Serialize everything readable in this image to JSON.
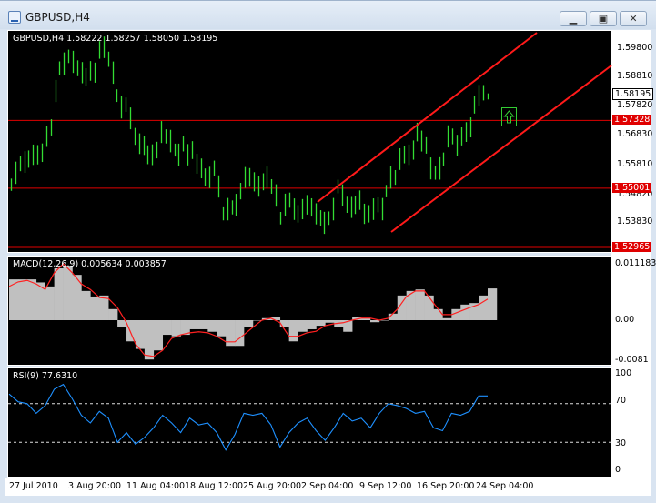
{
  "window": {
    "title": "GBPUSD,H4",
    "buttons": [
      "minimize",
      "maximize",
      "close"
    ]
  },
  "price_pane": {
    "legend": "GBPUSD,H4  1.58222 1.58257 1.58050 1.58195",
    "axis_labels": [
      "1.59800",
      "1.58810",
      "1.57820",
      "1.56830",
      "1.55810",
      "1.54820",
      "1.53830"
    ],
    "current_price": "1.58195",
    "hlines": [
      "1.57328",
      "1.55001",
      "1.52965"
    ]
  },
  "macd_pane": {
    "legend": "MACD(12,26,9) 0.005634 0.003857",
    "axis_labels": [
      "0.011183",
      "0.00",
      "-0.0081"
    ]
  },
  "rsi_pane": {
    "legend": "RSI(9) 77.6310",
    "axis_labels": [
      "100",
      "70",
      "30",
      "0"
    ]
  },
  "time_axis": [
    "27 Jul 2010",
    "3 Aug 20:00",
    "11 Aug 04:00",
    "18 Aug 12:00",
    "25 Aug 20:00",
    "2 Sep 04:00",
    "9 Sep 12:00",
    "16 Sep 20:00",
    "24 Sep 04:00"
  ],
  "colors": {
    "bars": "#33dd33",
    "hline": "#e00000",
    "macd_hist": "#c0c0c0",
    "macd_signal": "#ff2020",
    "rsi": "#1e90ff"
  },
  "chart_data": [
    {
      "type": "bar",
      "title": "GBPUSD,H4",
      "ylim": [
        1.5297,
        1.598
      ],
      "typical_range": 0.007,
      "last_bar": {
        "open": 1.58222,
        "high": 1.58257,
        "low": 1.5805,
        "close": 1.58195
      },
      "mid_prices": [
        1.5512,
        1.5553,
        1.5584,
        1.559,
        1.56,
        1.5615,
        1.5615,
        1.5622,
        1.5678,
        1.5709,
        1.5834,
        1.5912,
        1.5928,
        1.5953,
        1.5934,
        1.5912,
        1.5897,
        1.5881,
        1.5903,
        1.5897,
        1.5975,
        1.5984,
        1.5943,
        1.5897,
        1.5818,
        1.5778,
        1.5787,
        1.574,
        1.5678,
        1.5653,
        1.5647,
        1.5615,
        1.5615,
        1.5631,
        1.5693,
        1.5678,
        1.5662,
        1.5631,
        1.5615,
        1.5653,
        1.5615,
        1.5631,
        1.5584,
        1.5568,
        1.5537,
        1.5537,
        1.5568,
        1.5506,
        1.5412,
        1.5428,
        1.5434,
        1.5443,
        1.549,
        1.5537,
        1.5537,
        1.5522,
        1.5506,
        1.5522,
        1.5537,
        1.5506,
        1.5475,
        1.5397,
        1.5443,
        1.5459,
        1.5428,
        1.5412,
        1.5428,
        1.5443,
        1.5434,
        1.5412,
        1.5397,
        1.5381,
        1.5397,
        1.5428,
        1.5506,
        1.5475,
        1.5443,
        1.5434,
        1.5443,
        1.5459,
        1.5412,
        1.5412,
        1.5428,
        1.5443,
        1.5428,
        1.549,
        1.5537,
        1.5537,
        1.56,
        1.5615,
        1.5615,
        1.5631,
        1.5693,
        1.5662,
        1.5647,
        1.5568,
        1.5553,
        1.5568,
        1.56,
        1.5678,
        1.5678,
        1.5647,
        1.5678,
        1.5693,
        1.5709,
        1.5787,
        1.5818,
        1.5828,
        1.5815
      ]
    },
    {
      "type": "bar",
      "title": "MACD(12,26,9)",
      "ylim": [
        -0.0081,
        0.011183
      ],
      "histogram": [
        0.0081,
        0.0081,
        0.0081,
        0.0075,
        0.0067,
        0.0103,
        0.0108,
        0.009,
        0.0058,
        0.0047,
        0.0049,
        0.0022,
        -0.0014,
        -0.0042,
        -0.0057,
        -0.0078,
        -0.006,
        -0.0029,
        -0.0032,
        -0.0029,
        -0.0018,
        -0.0018,
        -0.0023,
        -0.0032,
        -0.0051,
        -0.0051,
        -0.0014,
        0,
        0.0004,
        0.0007,
        -0.0014,
        -0.0042,
        -0.0023,
        -0.0018,
        -0.0011,
        -0.0005,
        -0.0014,
        -0.0023,
        0.0007,
        0.0004,
        -0.0004,
        0,
        0.0013,
        0.0049,
        0.0058,
        0.0061,
        0.0049,
        0.0022,
        0.0004,
        0.0022,
        0.0031,
        0.0034,
        0.0049,
        0.0063
      ],
      "signal": [
        0.0067,
        0.0076,
        0.0079,
        0.0072,
        0.0061,
        0.0094,
        0.0112,
        0.0094,
        0.0072,
        0.0061,
        0.0045,
        0.0043,
        0.0025,
        -0.0005,
        -0.0047,
        -0.0069,
        -0.0072,
        -0.006,
        -0.0036,
        -0.0029,
        -0.0025,
        -0.0023,
        -0.0025,
        -0.0032,
        -0.0043,
        -0.0043,
        -0.0029,
        -0.0014,
        0,
        0.0004,
        -0.0005,
        -0.0032,
        -0.0032,
        -0.0025,
        -0.0022,
        -0.0011,
        -0.0007,
        -0.0005,
        0,
        0.0004,
        0.0004,
        0,
        0.0004,
        0.0022,
        0.0047,
        0.0058,
        0.0058,
        0.0034,
        0.0011,
        0.0011,
        0.0018,
        0.0025,
        0.0031,
        0.0042
      ]
    },
    {
      "type": "line",
      "title": "RSI(9)",
      "ylim": [
        0,
        100
      ],
      "levels": [
        70,
        30
      ],
      "values": [
        80,
        72,
        70,
        60,
        68,
        85,
        90,
        75,
        58,
        50,
        62,
        55,
        30,
        40,
        28,
        35,
        45,
        58,
        50,
        40,
        55,
        48,
        50,
        40,
        22,
        38,
        60,
        58,
        60,
        48,
        25,
        40,
        50,
        55,
        42,
        32,
        45,
        60,
        52,
        55,
        45,
        60,
        70,
        68,
        65,
        60,
        62,
        45,
        42,
        60,
        58,
        62,
        78,
        78
      ]
    }
  ]
}
